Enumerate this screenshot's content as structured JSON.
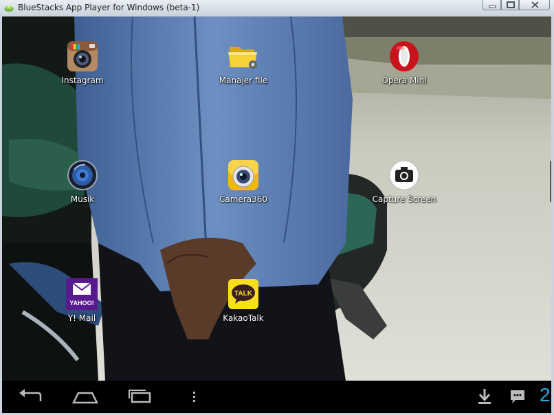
{
  "window": {
    "title": "BlueStacks App Player for Windows (beta-1)",
    "controls": [
      "minimize",
      "maximize",
      "close"
    ]
  },
  "apps": [
    {
      "label": "Instagram",
      "icon": "instagram-icon"
    },
    {
      "label": "Manajer file",
      "icon": "folder-icon"
    },
    {
      "label": "Opera Mini",
      "icon": "opera-icon"
    },
    {
      "label": "Musik",
      "icon": "speaker-icon"
    },
    {
      "label": "Camera360",
      "icon": "camera360-icon"
    },
    {
      "label": "Capture Screen",
      "icon": "camera-icon"
    },
    {
      "label": "Y! Mail",
      "icon": "yahoo-mail-icon",
      "badge": "YAHOO!"
    },
    {
      "label": "KakaoTalk",
      "icon": "kakaotalk-icon",
      "badge": "TALK"
    }
  ],
  "navbar": {
    "buttons": [
      "back-icon",
      "home-icon",
      "recent-apps-icon",
      "menu-icon",
      "download-icon",
      "chat-icon"
    ],
    "edge_text": "2"
  }
}
